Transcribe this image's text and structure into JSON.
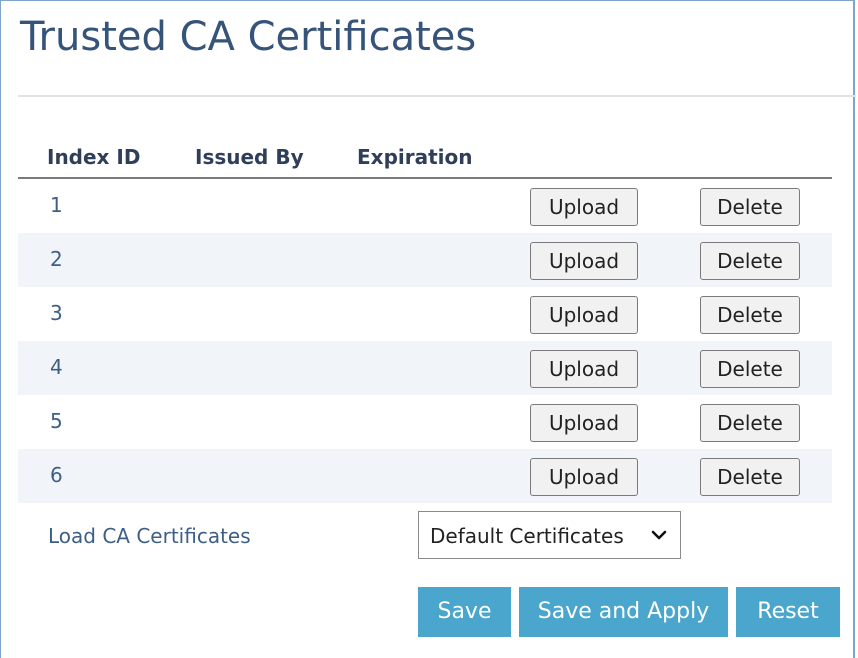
{
  "page": {
    "title": "Trusted CA Certificates"
  },
  "table": {
    "headers": [
      "Index ID",
      "Issued By",
      "Expiration"
    ],
    "rows": [
      {
        "index": "1",
        "issued_by": "",
        "expiration": "",
        "upload_label": "Upload",
        "delete_label": "Delete"
      },
      {
        "index": "2",
        "issued_by": "",
        "expiration": "",
        "upload_label": "Upload",
        "delete_label": "Delete"
      },
      {
        "index": "3",
        "issued_by": "",
        "expiration": "",
        "upload_label": "Upload",
        "delete_label": "Delete"
      },
      {
        "index": "4",
        "issued_by": "",
        "expiration": "",
        "upload_label": "Upload",
        "delete_label": "Delete"
      },
      {
        "index": "5",
        "issued_by": "",
        "expiration": "",
        "upload_label": "Upload",
        "delete_label": "Delete"
      },
      {
        "index": "6",
        "issued_by": "",
        "expiration": "",
        "upload_label": "Upload",
        "delete_label": "Delete"
      }
    ]
  },
  "load_ca": {
    "label": "Load CA Certificates",
    "selected": "Default Certificates"
  },
  "actions": {
    "save": "Save",
    "save_and_apply": "Save and Apply",
    "reset": "Reset"
  },
  "colors": {
    "title": "#36537a",
    "link_text": "#3d5f86",
    "action_button": "#4aa6cd",
    "alt_row": "#f1f5fa"
  },
  "icons": {
    "dropdown": "chevron-down-icon"
  }
}
